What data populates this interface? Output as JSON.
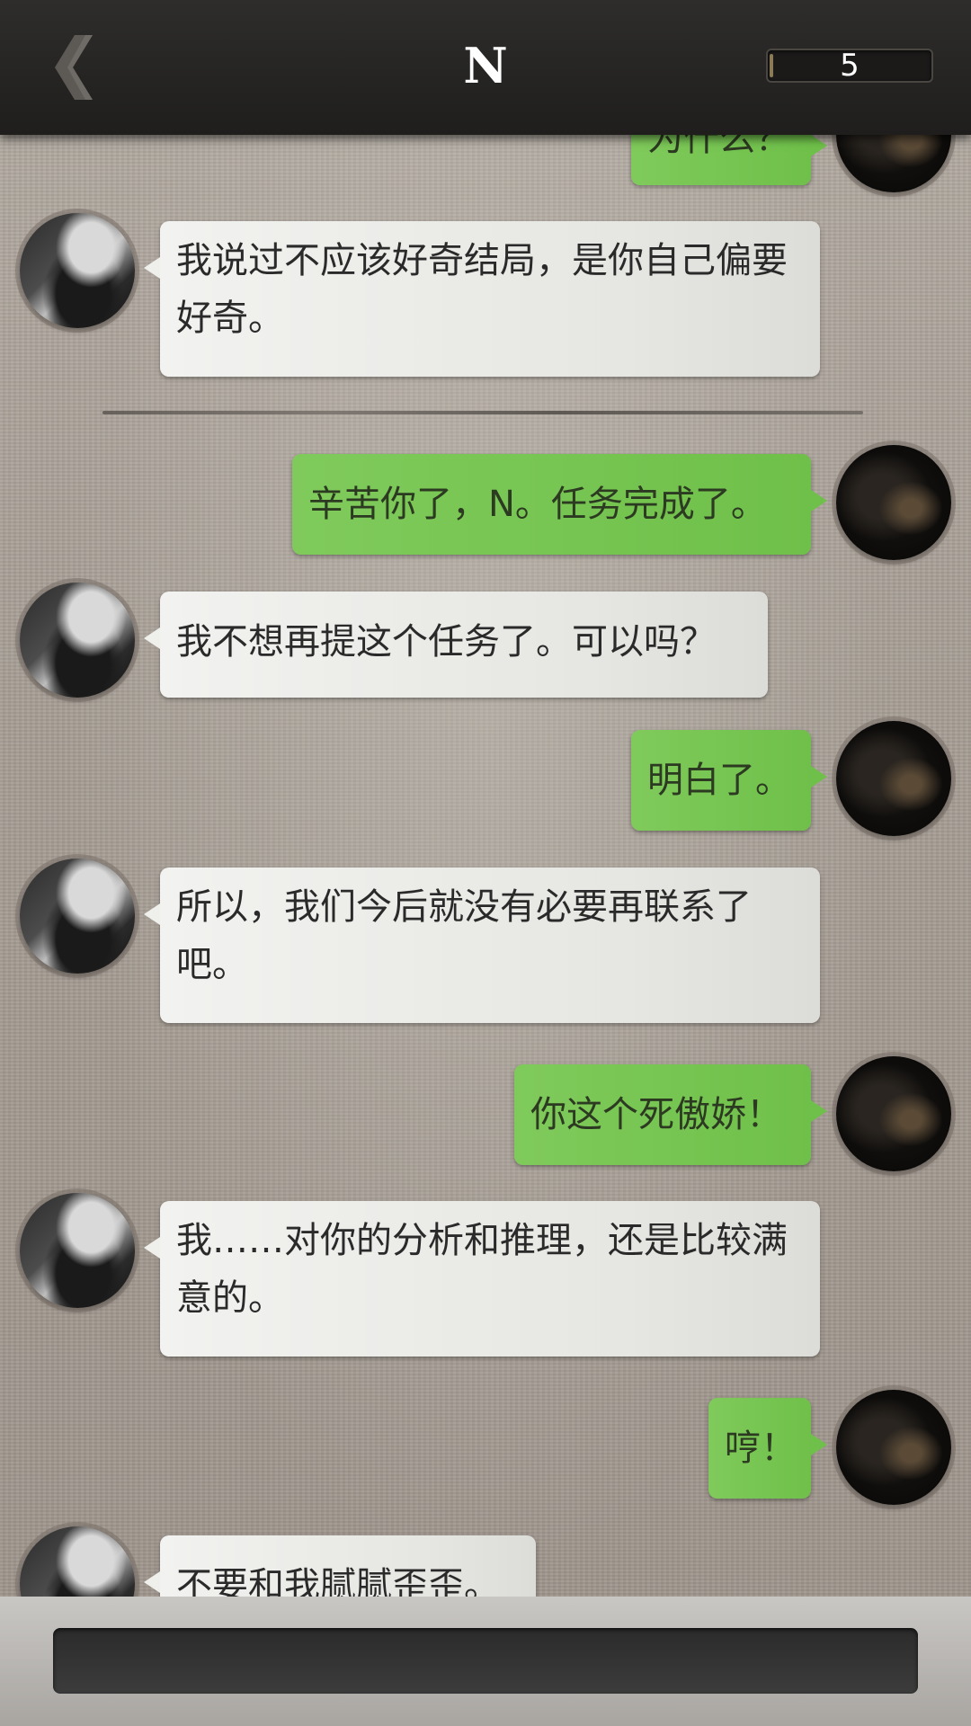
{
  "header": {
    "title": "N",
    "counter": "5"
  },
  "messages": [
    {
      "side": "right",
      "text": "为什么？"
    },
    {
      "side": "left",
      "text": "我说过不应该好奇结局，是你自己偏要好奇。"
    },
    {
      "side": "right",
      "text": "辛苦你了，N。任务完成了。"
    },
    {
      "side": "left",
      "text": "我不想再提这个任务了。可以吗？"
    },
    {
      "side": "right",
      "text": "明白了。"
    },
    {
      "side": "left",
      "text": "所以，我们今后就没有必要再联系了吧。"
    },
    {
      "side": "right",
      "text": "你这个死傲娇！"
    },
    {
      "side": "left",
      "text": "我……对你的分析和推理，还是比较满意的。"
    },
    {
      "side": "right",
      "text": "哼！"
    },
    {
      "side": "left",
      "text": "不要和我腻腻歪歪。"
    }
  ],
  "icons": {
    "back": "chevron-left-icon"
  }
}
